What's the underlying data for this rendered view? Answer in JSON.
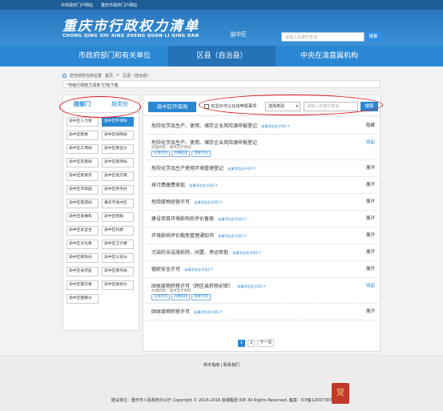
{
  "top_strip": {
    "link1": "中央政府门户网站",
    "link2": "重庆市政府门户网站"
  },
  "header": {
    "title": "重庆市行政权力清单",
    "pinyin": "CHONG QING SHI XING ZHENG QUAN LI QING DAN",
    "region": "渝中区",
    "search_placeholder": "请输入关键字查询",
    "search_button": "搜索"
  },
  "nav": {
    "tabs": [
      "市政府部门和有关单位",
      "区县（自治县）",
      "中央在渝直属机构"
    ]
  },
  "breadcrumb": {
    "prefix": "您当前所在的位置",
    "home": "首页",
    "sep": ">",
    "current": "区县（自治县）"
  },
  "package_notice": "\"市级行政权力清单\"打包下载",
  "sidebar": {
    "tab_department": "按部门",
    "tab_category": "按类别",
    "departments": [
      "渝中区人力资",
      "渝中区环保局",
      "渝中区教委",
      "渝中区财政局",
      "渝中区工商局",
      "渝中区质监分",
      "渝中区房管局",
      "渝中区民政局",
      "渝中区民族宗",
      "渝中区地方税",
      "渝中区市政园",
      "渝中区侨务办",
      "渝中区旅游局",
      "重庆市渝中区",
      "渝中区发展和",
      "渝中区残联",
      "渝中区安全生",
      "渝中区科委",
      "渝中区文化委",
      "渝中区卫计委",
      "渝中区民防办",
      "渝中区公安分",
      "渝中区食药监",
      "渝中区商务局",
      "渝中区建交委",
      "渝中区规划分",
      "渝中区国税分"
    ],
    "active_index": 1
  },
  "panel": {
    "title": "渝中区环保局",
    "checkbox_label": "仅显示可以在线申报事项",
    "type_select": "选择类别",
    "keyword_placeholder": "请输入关键字查询",
    "search_button": "搜索",
    "items": [
      {
        "name": "危险化学品生产、使用、储存企业风险源申报登记",
        "sub": "该事项包含子项1个",
        "action": "隐藏"
      },
      {
        "name": "危险化学品生产、使用、储存企业风险源申报登记",
        "sub": "",
        "action": "收起",
        "meta": "办理机构：渝中区环保局",
        "tags": [
          "在线咨询",
          "办事指南",
          "我要咨询"
        ]
      },
      {
        "name": "危险化学品生产使用环境管理登记",
        "sub": "该事项包含子项1个",
        "action": "展开"
      },
      {
        "name": "排污费缴费审批",
        "sub": "该事项包含子项1个",
        "action": "展开"
      },
      {
        "name": "危险废物经营许可",
        "sub": "该事项包含子项1个",
        "action": "展开"
      },
      {
        "name": "建设项目环境影响后评价备案",
        "sub": "该事项包含子项1个",
        "action": "展开"
      },
      {
        "name": "环境影响评价豁免管理通知书",
        "sub": "该事项包含子项1个",
        "action": "展开"
      },
      {
        "name": "污染防治设施拆除、闲置、停运审批",
        "sub": "该事项包含子项1个",
        "action": "展开"
      },
      {
        "name": "辐射安全许可",
        "sub": "该事项包含子项1个",
        "action": "展开"
      },
      {
        "name": "固体废物转移许可（跨区县转移初审）",
        "sub": "该事项包含子项1个",
        "action": "收起",
        "meta": "办理机构：渝中区环保局",
        "tags": [
          "在线咨询",
          "办事指南",
          "我要咨询"
        ]
      },
      {
        "name": "固体废物转移许可",
        "sub": "该事项包含子项1个",
        "action": "展开"
      }
    ]
  },
  "pagination": {
    "pages": [
      "1",
      "2"
    ],
    "next": "下一页",
    "current": "1"
  },
  "footer": {
    "links": "新手指南 | 联系我们",
    "info": "建设单位：重庆市人民政府办公厅   Copyright © 2014-2016 浪潮集团 IOP. All Rights Reserved.   备案：ICP备12007387",
    "badge": "党"
  },
  "colors": {
    "primary": "#2a87d3",
    "annotation": "#d8141a"
  }
}
